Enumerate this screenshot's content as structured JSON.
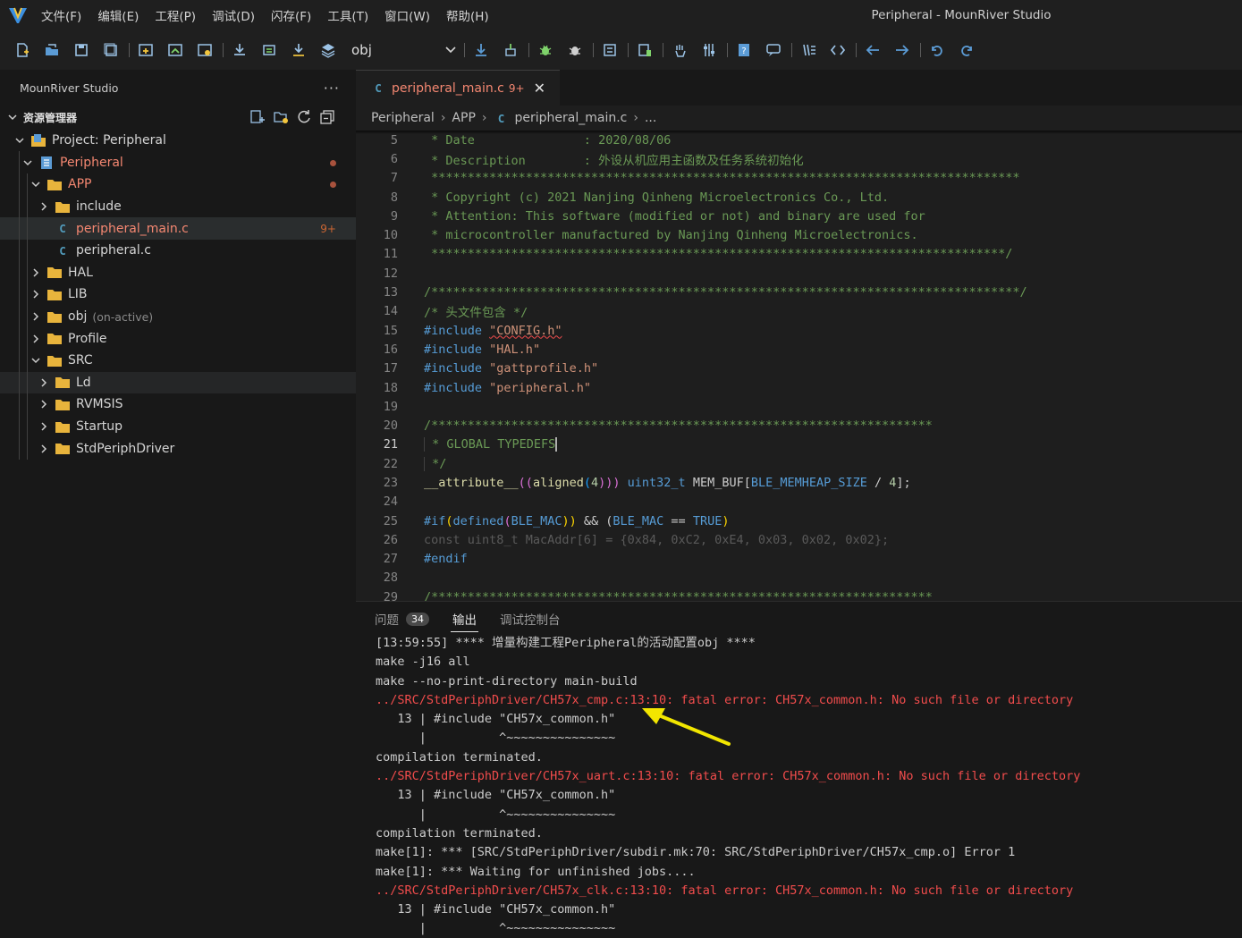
{
  "app": {
    "window_title": "Peripheral - MounRiver Studio"
  },
  "menu": [
    {
      "label": "文件(F)"
    },
    {
      "label": "编辑(E)"
    },
    {
      "label": "工程(P)"
    },
    {
      "label": "调试(D)"
    },
    {
      "label": "闪存(F)"
    },
    {
      "label": "工具(T)"
    },
    {
      "label": "窗口(W)"
    },
    {
      "label": "帮助(H)"
    }
  ],
  "toolbar": {
    "config_select": "obj"
  },
  "sidebar": {
    "title": "MounRiver Studio",
    "more": "···",
    "section": "资源管理器",
    "tree": [
      {
        "label": "Project: Peripheral"
      },
      {
        "label": "Peripheral"
      },
      {
        "label": "APP"
      },
      {
        "label": "include"
      },
      {
        "label": "peripheral_main.c",
        "badge": "9+"
      },
      {
        "label": "peripheral.c"
      },
      {
        "label": "HAL"
      },
      {
        "label": "LIB"
      },
      {
        "label": "obj",
        "note": "(on-active)"
      },
      {
        "label": "Profile"
      },
      {
        "label": "SRC"
      },
      {
        "label": "Ld"
      },
      {
        "label": "RVMSIS"
      },
      {
        "label": "Startup"
      },
      {
        "label": "StdPeriphDriver"
      }
    ]
  },
  "editor": {
    "tab": {
      "file_icon": "C",
      "name": "peripheral_main.c",
      "badge": "9+",
      "close": "✕"
    },
    "breadcrumb": [
      "Peripheral",
      "APP",
      "peripheral_main.c",
      "..."
    ],
    "line_numbers": [
      "5",
      "6",
      "7",
      "8",
      "9",
      "10",
      "11",
      "12",
      "13",
      "14",
      "15",
      "16",
      "17",
      "18",
      "19",
      "20",
      "21",
      "22",
      "23",
      "24",
      "25",
      "26",
      "27",
      "28",
      "29"
    ],
    "current_line": "21",
    "code": {
      "l5": " * Date               : 2020/08/06",
      "l6": " * Description        : 外设从机应用主函数及任务系统初始化",
      "l7": " *********************************************************************************",
      "l8": " * Copyright (c) 2021 Nanjing Qinheng Microelectronics Co., Ltd.",
      "l9": " * Attention: This software (modified or not) and binary are used for",
      "l10": " * microcontroller manufactured by Nanjing Qinheng Microelectronics.",
      "l11": " *******************************************************************************/",
      "l13": "/*********************************************************************************/",
      "l14": "/* 头文件包含 */",
      "l15_kw": "#include",
      "l15_str": "\"CONFIG.h\"",
      "l16_kw": "#include",
      "l16_str": "\"HAL.h\"",
      "l17_kw": "#include",
      "l17_str": "\"gattprofile.h\"",
      "l18_kw": "#include",
      "l18_str": "\"peripheral.h\"",
      "l20": "/*********************************************************************",
      "l21": " * GLOBAL TYPEDEFS",
      "l22": " */",
      "l23_a": "__attribute__",
      "l23_b": "((",
      "l23_c": "aligned",
      "l23_d": "(",
      "l23_e": "4",
      "l23_f": ")))",
      "l23_g": "uint32_t",
      "l23_h": " MEM_BUF[",
      "l23_i": "BLE_MEMHEAP_SIZE",
      "l23_j": " / ",
      "l23_k": "4",
      "l23_l": "];",
      "l25_a": "#if",
      "l25_b": "(",
      "l25_c": "defined",
      "l25_d": "(",
      "l25_e": "BLE_MAC",
      "l25_f": "))",
      "l25_g": " && (",
      "l25_h": "BLE_MAC",
      "l25_i": " == ",
      "l25_j": "TRUE",
      "l25_k": ")",
      "l26": "const uint8_t MacAddr[6] = {0x84, 0xC2, 0xE4, 0x03, 0x02, 0x02};",
      "l27": "#endif",
      "l29": "/*********************************************************************"
    }
  },
  "panel": {
    "tabs": [
      {
        "label": "问题",
        "badge": "34"
      },
      {
        "label": "输出"
      },
      {
        "label": "调试控制台"
      }
    ],
    "output": [
      {
        "text": "[13:59:55] **** 增量构建工程Peripheral的活动配置obj ****",
        "kind": "normal"
      },
      {
        "text": "make -j16 all",
        "kind": "normal"
      },
      {
        "text": "make --no-print-directory main-build",
        "kind": "normal"
      },
      {
        "text": "../SRC/StdPeriphDriver/CH57x_cmp.c:13:10: fatal error: CH57x_common.h: No such file or directory",
        "kind": "error"
      },
      {
        "text": "   13 | #include \"CH57x_common.h\"",
        "kind": "normal"
      },
      {
        "text": "      |          ^~~~~~~~~~~~~~~~",
        "kind": "normal"
      },
      {
        "text": "compilation terminated.",
        "kind": "normal"
      },
      {
        "text": "../SRC/StdPeriphDriver/CH57x_uart.c:13:10: fatal error: CH57x_common.h: No such file or directory",
        "kind": "error"
      },
      {
        "text": "   13 | #include \"CH57x_common.h\"",
        "kind": "normal"
      },
      {
        "text": "      |          ^~~~~~~~~~~~~~~~",
        "kind": "normal"
      },
      {
        "text": "compilation terminated.",
        "kind": "normal"
      },
      {
        "text": "make[1]: *** [SRC/StdPeriphDriver/subdir.mk:70: SRC/StdPeriphDriver/CH57x_cmp.o] Error 1",
        "kind": "normal"
      },
      {
        "text": "make[1]: *** Waiting for unfinished jobs....",
        "kind": "normal"
      },
      {
        "text": "../SRC/StdPeriphDriver/CH57x_clk.c:13:10: fatal error: CH57x_common.h: No such file or directory",
        "kind": "error"
      },
      {
        "text": "   13 | #include \"CH57x_common.h\"",
        "kind": "normal"
      },
      {
        "text": "      |          ^~~~~~~~~~~~~~~~",
        "kind": "normal"
      }
    ]
  },
  "colors": {
    "accent_error": "#f14c4c",
    "annotation_arrow": "#f2e600",
    "folder": "#e8b43c"
  }
}
